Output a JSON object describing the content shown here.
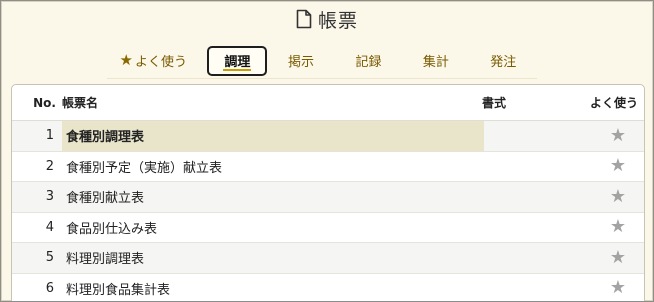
{
  "header": {
    "title": "帳票",
    "icon": "document-icon"
  },
  "tabs": [
    {
      "label": "よく使う",
      "icon": "star-icon",
      "active": false
    },
    {
      "label": "調理",
      "active": true
    },
    {
      "label": "掲示",
      "active": false
    },
    {
      "label": "記録",
      "active": false
    },
    {
      "label": "集計",
      "active": false
    },
    {
      "label": "発注",
      "active": false
    }
  ],
  "table": {
    "columns": {
      "no": "No.",
      "name": "帳票名",
      "format": "書式",
      "favorite": "よく使う"
    },
    "rows": [
      {
        "no": "1",
        "name": "食種別調理表",
        "selected": true
      },
      {
        "no": "2",
        "name": "食種別予定（実施）献立表"
      },
      {
        "no": "3",
        "name": "食種別献立表"
      },
      {
        "no": "4",
        "name": "食品別仕込み表"
      },
      {
        "no": "5",
        "name": "料理別調理表"
      },
      {
        "no": "6",
        "name": "料理別食品集計表"
      }
    ]
  },
  "colors": {
    "background": "#fbf8ea",
    "accent": "#c9a000",
    "tab_text": "#7a5a00",
    "selected_row": "#e9e5cb",
    "star_inactive": "#a3a3a3"
  }
}
